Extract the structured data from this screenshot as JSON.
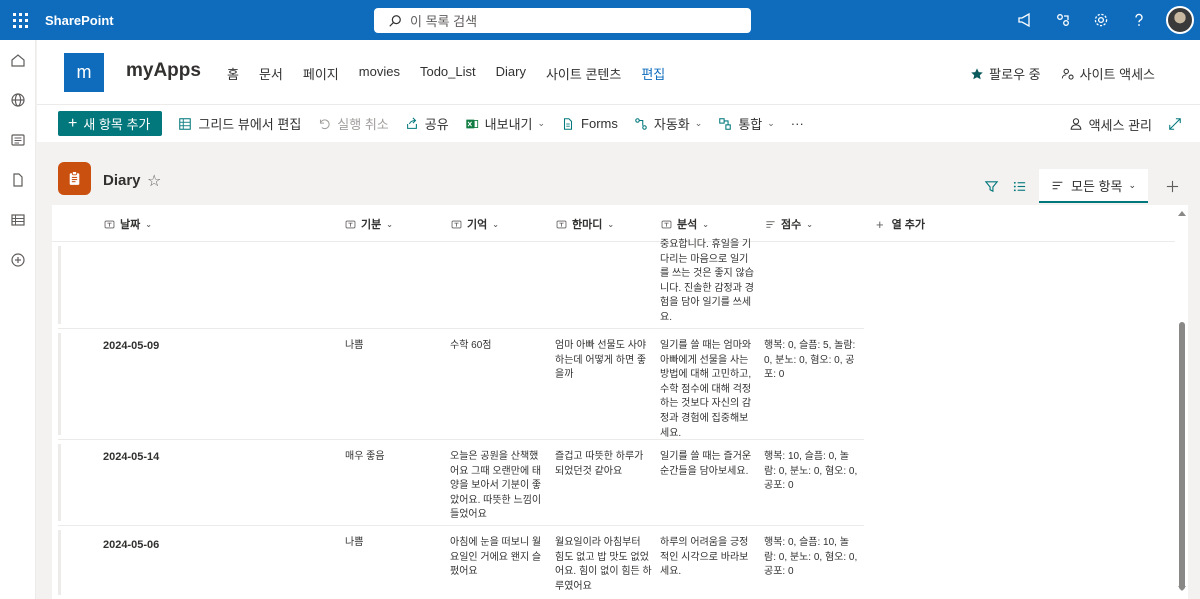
{
  "suite": {
    "brand": "SharePoint",
    "search_placeholder": "이 목록 검색"
  },
  "site": {
    "logo_letter": "m",
    "title": "myApps",
    "nav": [
      "홈",
      "문서",
      "페이지",
      "movies",
      "Todo_List",
      "Diary",
      "사이트 콘텐츠",
      "편집"
    ],
    "follow": "팔로우 중",
    "access": "사이트 액세스"
  },
  "toolbar": {
    "new_item": "새 항목 추가",
    "grid_edit": "그리드 뷰에서 편집",
    "undo": "실행 취소",
    "share": "공유",
    "export": "내보내기",
    "forms": "Forms",
    "automate": "자동화",
    "integrate": "통합",
    "more": "···",
    "manage_access": "액세스 관리"
  },
  "list": {
    "title": "Diary",
    "view": "모든 항목"
  },
  "columns": {
    "date": "날짜",
    "mood": "기분",
    "memory": "기억",
    "remark": "한마디",
    "analysis": "분석",
    "score": "점수",
    "add": "열 추가"
  },
  "rows": [
    {
      "date": "",
      "mood": "",
      "memory": "",
      "remark": "",
      "analysis": "중요합니다. 휴일을 기다리는 마음으로 일기를 쓰는 것은 좋지 않습니다. 진솔한 감정과 경험을 담아 일기를 쓰세요.",
      "score": ""
    },
    {
      "date": "2024-05-09",
      "mood": "나쁨",
      "memory": "수학 60점",
      "remark": "엄마 아빠 선물도 사야하는데 어떻게 하면 좋을까",
      "analysis": "일기를 쓸 때는 엄마와 아빠에게 선물을 사는 방법에 대해 고민하고, 수학 점수에 대해 걱정하는 것보다 자신의 감정과 경험에 집중해보세요.",
      "score": "행복: 0, 슬픔: 5, 놀람: 0, 분노: 0, 혐오: 0, 공포: 0"
    },
    {
      "date": "2024-05-14",
      "mood": "매우 좋음",
      "memory": "오늘은 공원을 산책했어요 그때 오랜만에 태양을 보아서 기분이 좋았어요. 따뜻한 느낌이 들었어요",
      "remark": "즐겁고 따뜻한 하루가 되었던것 같아요",
      "analysis": "일기를 쓸 때는 즐거운 순간들을 담아보세요.",
      "score": "행복: 10, 슬픔: 0, 놀람: 0, 분노: 0, 혐오: 0, 공포: 0"
    },
    {
      "date": "2024-05-06",
      "mood": "나쁨",
      "memory": "아침에 눈을 떠보니 월요일인 거에요 왠지 슬펐어요",
      "remark": "월요일이라 아침부터 힘도 없고 밥 맛도 없었어요. 힘이 없이 힘든 하루였어요",
      "analysis": "하루의 어려움을 긍정적인 시각으로 바라보세요.",
      "score": "행복: 0, 슬픔: 10, 놀람: 0, 분노: 0, 혐오: 0, 공포: 0"
    }
  ]
}
